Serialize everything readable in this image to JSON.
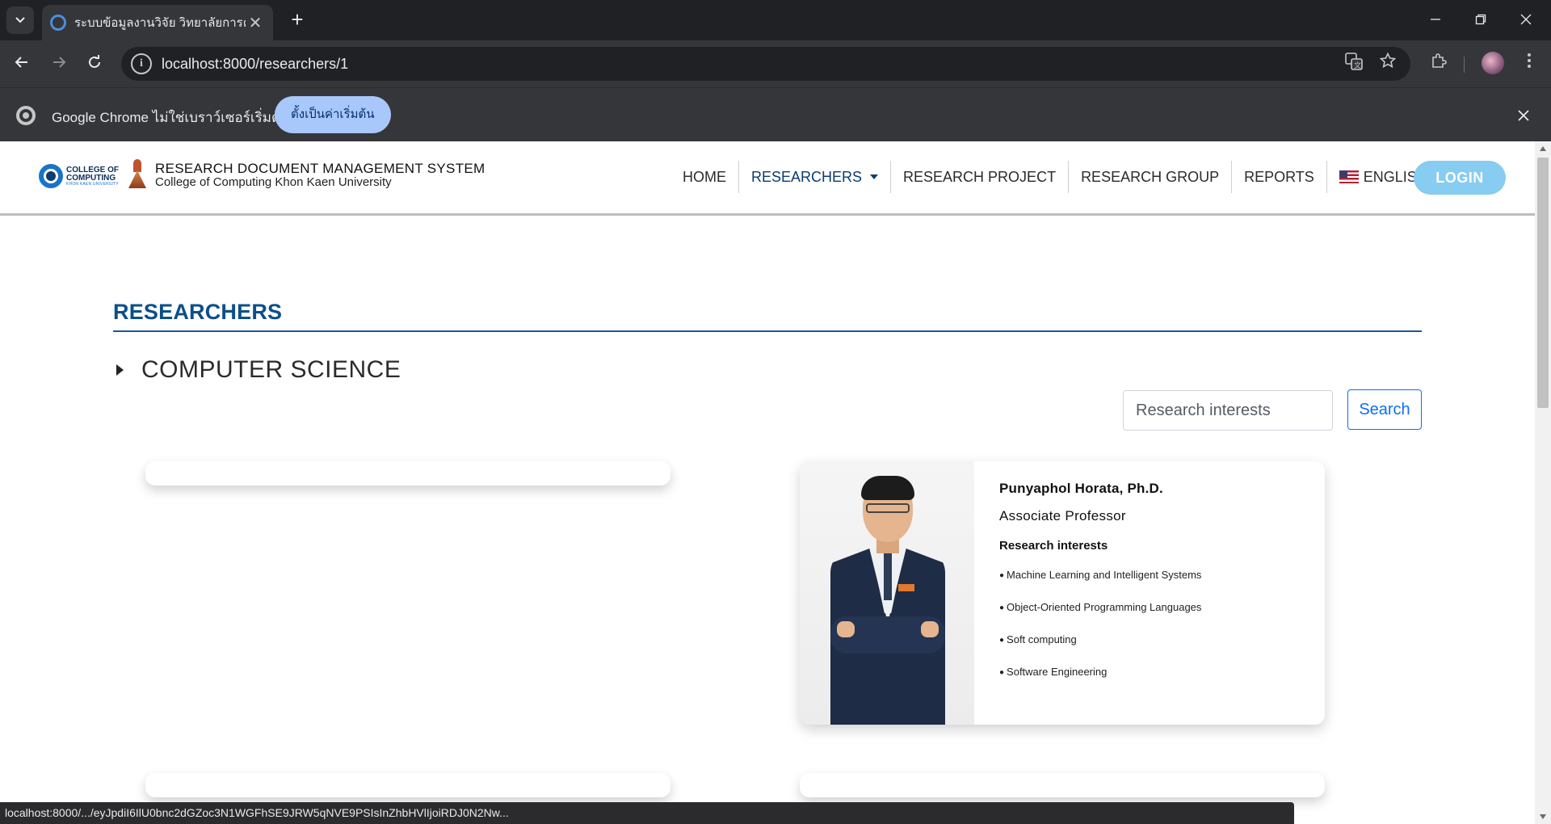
{
  "browser": {
    "tab_title": "ระบบข้อมูลงานวิจัย วิทยาลัยการคอมพิวเตอร์",
    "tab_close": "✕",
    "new_tab": "+",
    "url": "localhost:8000/researchers/1",
    "infobar_text": "Google Chrome ไม่ใช่เบราว์เซอร์เริ่มต้น",
    "infobar_button": "ตั้งเป็นค่าเริ่มต้น",
    "status_url": "localhost:8000/.../eyJpdiI6IlU0bnc2dGZoc3N1WGFhSE9JRW5qNVE9PSIsInZhbHVlIjoiRDJ0N2Nw..."
  },
  "site": {
    "logo_line1": "COLLEGE OF",
    "logo_line2": "COMPUTING",
    "logo_line3": "KHON KAEN UNIVERSITY",
    "title": "RESEARCH DOCUMENT MANAGEMENT SYSTEM",
    "subtitle": "College of Computing Khon Kaen University",
    "nav": {
      "home": "HOME",
      "researchers": "RESEARCHERS",
      "research_project": "RESEARCH PROJECT",
      "research_group": "RESEARCH GROUP",
      "reports": "REPORTS",
      "language": "ENGLISH"
    },
    "login": "LOGIN"
  },
  "page": {
    "section_title": "RESEARCHERS",
    "category": "COMPUTER SCIENCE",
    "search_placeholder": "Research interests",
    "search_button": "Search"
  },
  "researcher": {
    "name": "Punyaphol Horata, Ph.D.",
    "position": "Associate Professor",
    "interests_label": "Research interests",
    "interests": [
      "Machine Learning and Intelligent Systems",
      "Object-Oriented Programming Languages",
      "Soft computing",
      "Software Engineering"
    ]
  },
  "colors": {
    "brand_blue": "#0b4f8a",
    "login_button": "#87ccf1",
    "search_button": "#0d6efd"
  }
}
